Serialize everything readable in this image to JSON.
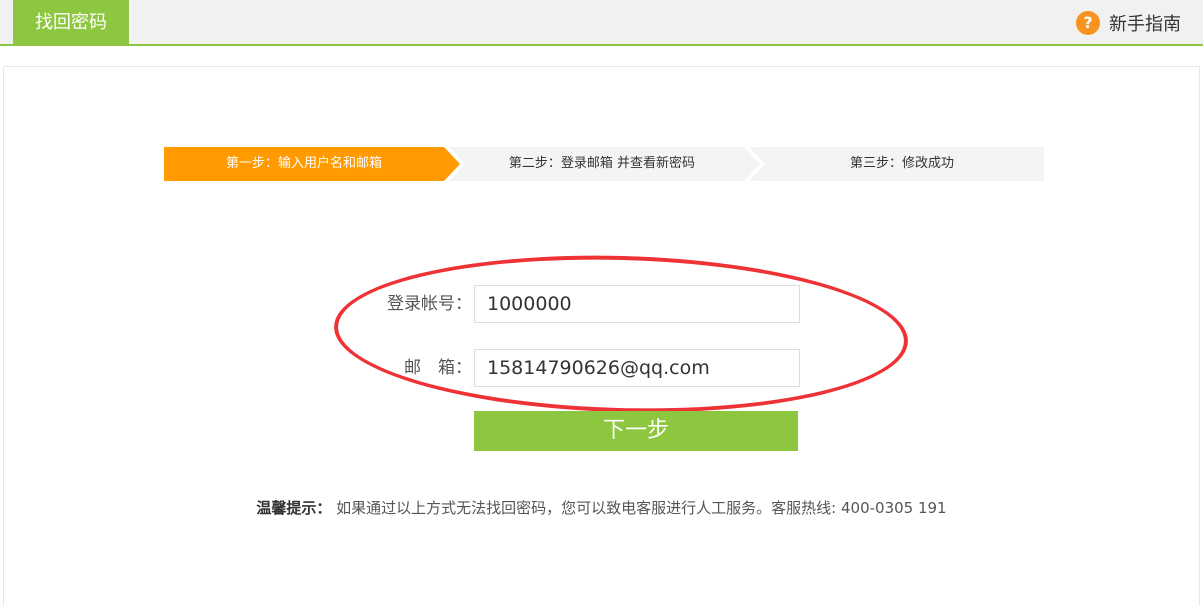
{
  "header": {
    "active_tab": "找回密码",
    "guide_label": "新手指南",
    "guide_icon": "question-circle-icon",
    "guide_icon_glyph": "?"
  },
  "steps": {
    "items": [
      {
        "label": "第一步：输入用户名和邮箱",
        "state": "active"
      },
      {
        "label": "第二步：登录邮箱 并查看新密码",
        "state": "inactive"
      },
      {
        "label": "第三步：修改成功",
        "state": "inactive"
      }
    ]
  },
  "form": {
    "account_label": "登录帐号：",
    "account_value": "1000000",
    "email_label": "邮　箱：",
    "email_value": "15814790626@qq.com",
    "submit_label": "下一步"
  },
  "tip": {
    "title": "温馨提示：",
    "text": " 如果通过以上方式无法找回密码，您可以致电客服进行人工服务。客服热线: 400-0305 191"
  },
  "colors": {
    "brand_green": "#8dc63f",
    "step_active": "#ff9a00",
    "step_inactive": "#f4f4f4",
    "annotation_red": "#ee3235",
    "guide_orange": "#f7931e"
  }
}
